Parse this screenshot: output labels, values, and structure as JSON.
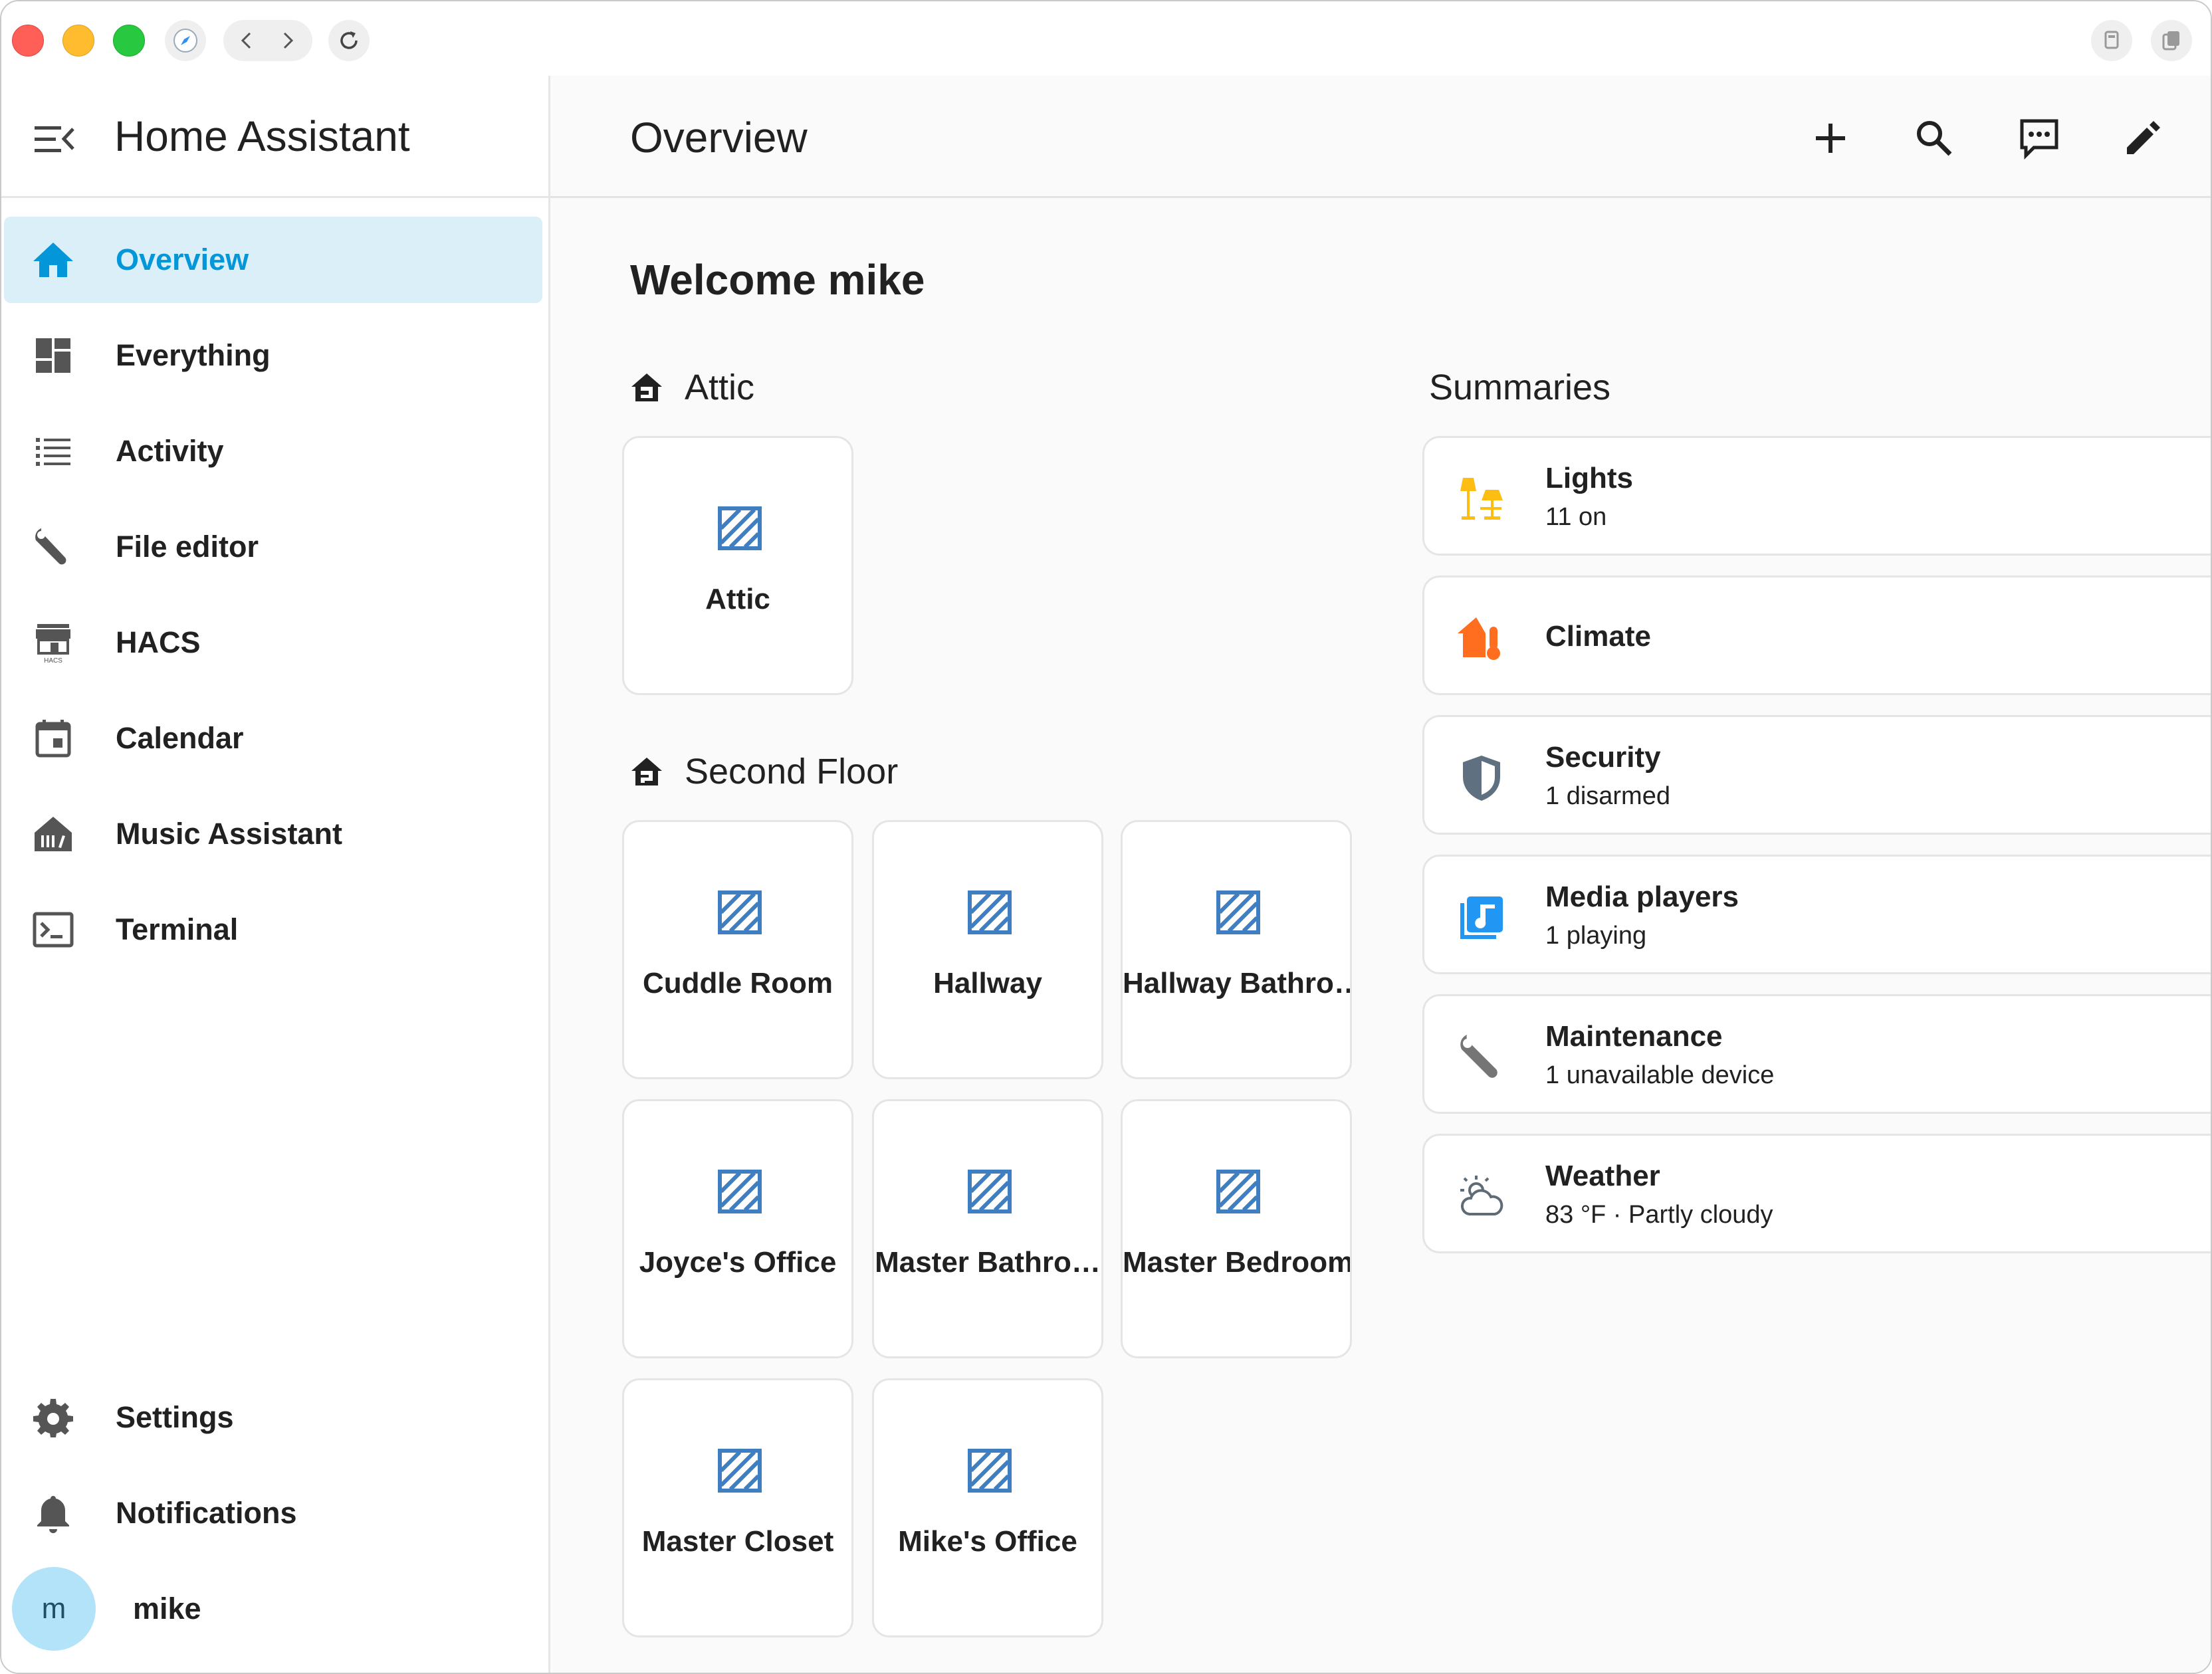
{
  "app": {
    "title": "Home Assistant"
  },
  "sidebar": {
    "items": [
      {
        "label": "Overview",
        "icon": "home-icon"
      },
      {
        "label": "Everything",
        "icon": "dashboard-icon"
      },
      {
        "label": "Activity",
        "icon": "list-icon"
      },
      {
        "label": "File editor",
        "icon": "wrench-icon"
      },
      {
        "label": "HACS",
        "icon": "hacs-store-icon"
      },
      {
        "label": "Calendar",
        "icon": "calendar-icon"
      },
      {
        "label": "Music Assistant",
        "icon": "music-library-icon"
      },
      {
        "label": "Terminal",
        "icon": "terminal-icon"
      }
    ],
    "bottom": [
      {
        "label": "Settings",
        "icon": "gear-icon"
      },
      {
        "label": "Notifications",
        "icon": "bell-icon"
      }
    ],
    "user": {
      "initial": "m",
      "name": "mike"
    }
  },
  "header": {
    "title": "Overview",
    "actions": [
      "add-icon",
      "search-icon",
      "assist-icon",
      "edit-icon"
    ]
  },
  "main": {
    "welcome": "Welcome mike",
    "floors": [
      {
        "name": "Attic",
        "areas": [
          "Attic"
        ]
      },
      {
        "name": "Second Floor",
        "areas": [
          "Cuddle Room",
          "Hallway",
          "Hallway Bathro…",
          "Joyce's Office",
          "Master Bathro…",
          "Master Bedroom",
          "Master Closet",
          "Mike's Office"
        ]
      }
    ],
    "summaries_title": "Summaries",
    "summaries": [
      {
        "title": "Lights",
        "subtitle": "11 on",
        "icon": "lamps-icon",
        "color": "#fdbd13"
      },
      {
        "title": "Climate",
        "subtitle": "",
        "icon": "home-thermometer-icon",
        "color": "#fe6e1e"
      },
      {
        "title": "Security",
        "subtitle": "1 disarmed",
        "icon": "shield-icon",
        "color": "#5f7180"
      },
      {
        "title": "Media players",
        "subtitle": "1 playing",
        "icon": "music-box-icon",
        "color": "#2196f3"
      },
      {
        "title": "Maintenance",
        "subtitle": "1 unavailable device",
        "icon": "wrench-icon",
        "color": "#757575"
      },
      {
        "title": "Weather",
        "subtitle": "83 °F · Partly cloudy",
        "icon": "weather-partly-cloudy-icon",
        "color": "#5f6b75"
      }
    ]
  },
  "colors": {
    "accent": "#0396d8",
    "active_bg": "#dbeff8",
    "area_icon": "#3f7fc1"
  }
}
